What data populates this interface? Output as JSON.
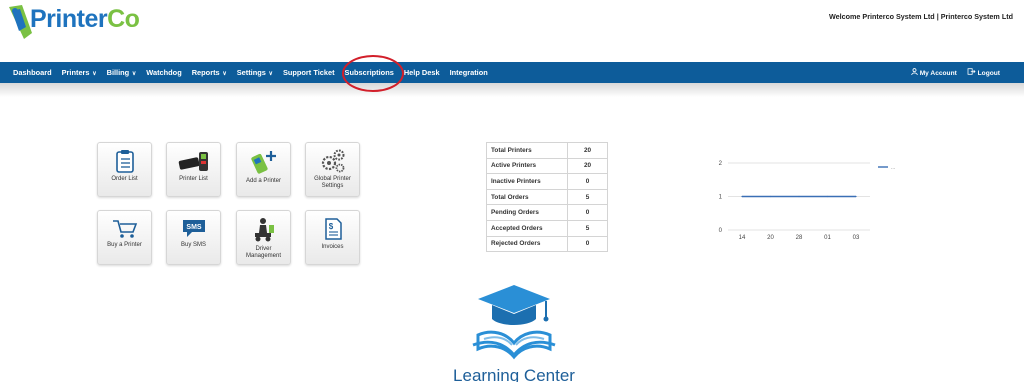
{
  "header": {
    "logo_text_a": "Printer",
    "logo_text_b": "Co",
    "welcome": "Welcome Printerco System Ltd | Printerco System Ltd"
  },
  "nav": {
    "items": [
      {
        "label": "Dashboard"
      },
      {
        "label": "Printers",
        "dropdown": true
      },
      {
        "label": "Billing",
        "dropdown": true
      },
      {
        "label": "Watchdog"
      },
      {
        "label": "Reports",
        "dropdown": true
      },
      {
        "label": "Settings",
        "dropdown": true
      },
      {
        "label": "Support Ticket"
      },
      {
        "label": "Subscriptions",
        "highlighted": true
      },
      {
        "label": "Help Desk"
      },
      {
        "label": "Integration"
      }
    ],
    "right": {
      "account": "My Account",
      "logout": "Logout"
    }
  },
  "tiles": [
    {
      "label": "Order List",
      "icon": "clipboard-icon"
    },
    {
      "label": "Printer List",
      "icon": "printer-icon"
    },
    {
      "label": "Add a Printer",
      "icon": "add-printer-icon"
    },
    {
      "label": "Global Printer Settings",
      "icon": "gears-icon"
    },
    {
      "label": "Buy a Printer",
      "icon": "cart-icon"
    },
    {
      "label": "Buy SMS",
      "icon": "sms-icon"
    },
    {
      "label": "Driver Management",
      "icon": "driver-icon"
    },
    {
      "label": "Invoices",
      "icon": "invoice-icon"
    }
  ],
  "stats": [
    {
      "label": "Total Printers",
      "value": "20"
    },
    {
      "label": "Active Printers",
      "value": "20"
    },
    {
      "label": "Inactive Printers",
      "value": "0"
    },
    {
      "label": "Total Orders",
      "value": "5"
    },
    {
      "label": "Pending Orders",
      "value": "0"
    },
    {
      "label": "Accepted Orders",
      "value": "5"
    },
    {
      "label": "Rejected Orders",
      "value": "0"
    }
  ],
  "chart_data": {
    "type": "line",
    "x": [
      "14",
      "20",
      "28",
      "01",
      "03"
    ],
    "series": [
      {
        "name": "...",
        "values": [
          1,
          1,
          1,
          1,
          1
        ]
      }
    ],
    "yticks": [
      0,
      1,
      2
    ],
    "ylim": [
      0,
      2
    ],
    "legend": "top-right",
    "grid": true
  },
  "learning_center": {
    "title": "Learning Center"
  },
  "colors": {
    "nav_bg": "#0d5c9a",
    "accent": "#1e73be",
    "brand_green": "#7ac143",
    "highlight": "#d21f2a"
  }
}
